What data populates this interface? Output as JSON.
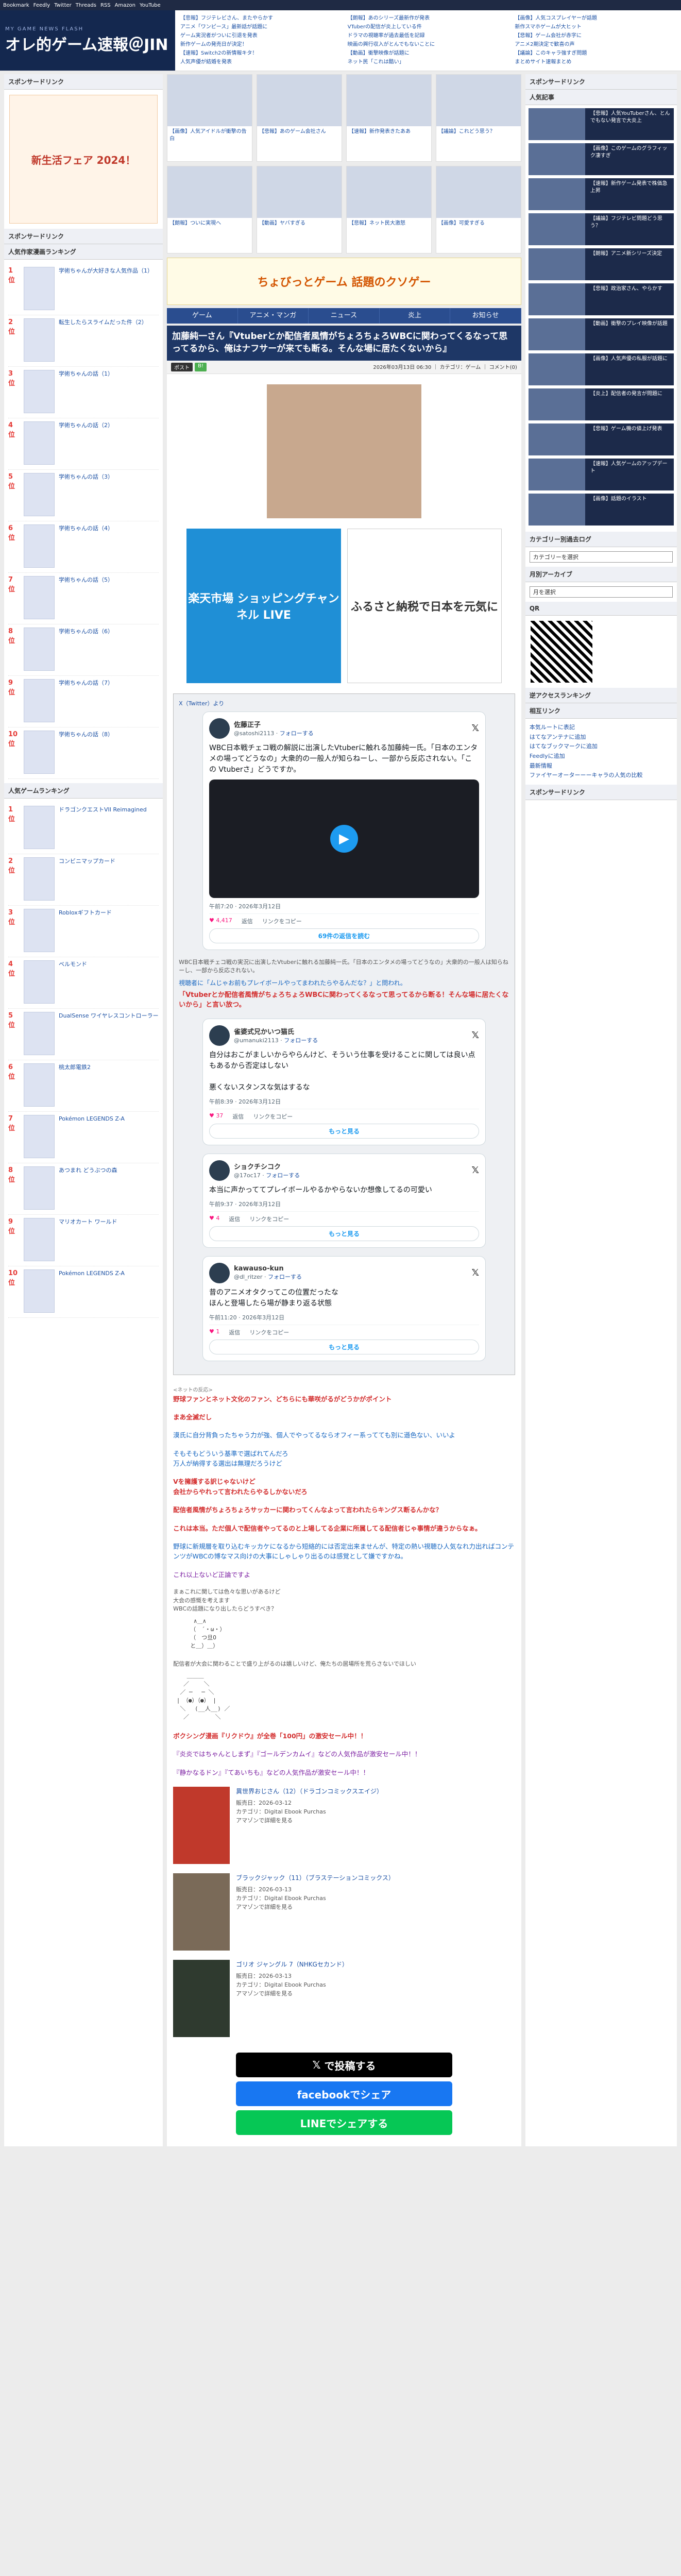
{
  "topbar": [
    "Bookmark",
    "Feedly",
    "Twitter",
    "Threads",
    "RSS",
    "Amazon",
    "YouTube"
  ],
  "site": {
    "sub": "MY GAME NEWS FLASH",
    "title": "オレ的ゲーム速報＠JIN"
  },
  "headlinks": [
    [
      "【悲報】フジテレビさん、またやらかす",
      "アニメ「ワンピース」最新話が話題に",
      "ゲーム実況者がついに引退を発表",
      "新作ゲームの発売日が決定！",
      "【速報】Switch2の新情報キタ！",
      "人気声優が結婚を発表"
    ],
    [
      "【朗報】あのシリーズ最新作が発表",
      "VTuberの配信が炎上している件",
      "ドラマの視聴率が過去最低を記録",
      "映画の興行収入がとんでもないことに",
      "【動画】衝撃映像が話題に",
      "ネット民「これは酷い」"
    ],
    [
      "【画像】人気コスプレイヤーが話題",
      "新作スマホゲームが大ヒット",
      "【悲報】ゲーム会社が赤字に",
      "アニメ2期決定で歓喜の声",
      "【議論】このキャラ強すぎ問題",
      "まとめサイト速報まとめ"
    ]
  ],
  "left": {
    "sponsor": "スポンサードリンク",
    "banner": "新生活フェア 2024！",
    "ranking_title": "人気作家漫画ランキング",
    "ranking": [
      {
        "no": "1位",
        "t": "学術ちゃんが大好きな人気作品（1）"
      },
      {
        "no": "2位",
        "t": "転生したらスライムだった件（2）"
      },
      {
        "no": "3位",
        "t": "学術ちゃんの話（1）"
      },
      {
        "no": "4位",
        "t": "学術ちゃんの話（2）"
      },
      {
        "no": "5位",
        "t": "学術ちゃんの話（3）"
      },
      {
        "no": "6位",
        "t": "学術ちゃんの話（4）"
      },
      {
        "no": "7位",
        "t": "学術ちゃんの話（5）"
      },
      {
        "no": "8位",
        "t": "学術ちゃんの話（6）"
      },
      {
        "no": "9位",
        "t": "学術ちゃんの話（7）"
      },
      {
        "no": "10位",
        "t": "学術ちゃんの話（8）"
      }
    ],
    "game_title": "人気ゲームランキング",
    "games": [
      {
        "no": "1位",
        "t": "ドラゴンクエストVII Reimagined"
      },
      {
        "no": "2位",
        "t": "コンビニマップカード"
      },
      {
        "no": "3位",
        "t": "Robloxギフトカード"
      },
      {
        "no": "4位",
        "t": "ベルモンド"
      },
      {
        "no": "5位",
        "t": "DualSense ワイヤレスコントローラー"
      },
      {
        "no": "6位",
        "t": "桃太郎電鉄2"
      },
      {
        "no": "7位",
        "t": "Pokémon LEGENDS Z-A"
      },
      {
        "no": "8位",
        "t": "あつまれ どうぶつの森"
      },
      {
        "no": "9位",
        "t": "マリオカート ワールド"
      },
      {
        "no": "10位",
        "t": "Pokémon LEGENDS Z-A"
      }
    ],
    "sponsor2": "スポンサードリンク"
  },
  "center": {
    "thumbs": [
      "【画像】人気アイドルが衝撃の告白",
      "【悲報】あのゲーム会社さん",
      "【速報】新作発表きたああ",
      "【議論】これどう思う？",
      "【朗報】ついに実現へ",
      "【動画】ヤバすぎる",
      "【悲報】ネット民大激怒",
      "【画像】可愛すぎる"
    ],
    "ad_strip": "ちょびっとゲーム 話題のクソゲー",
    "nav": [
      "ゲーム",
      "アニメ・マンガ",
      "ニュース",
      "炎上",
      "お知らせ"
    ],
    "title": "加藤純一さん『Vtuberとか配信者風情がちょろちょろWBCに関わってくるなって思ってるから、俺はナフサーが来ても断る。そんな場に居たくないから』",
    "meta": "2026年03月13日 06:30 ｜ カテゴリ：ゲーム ｜ コメント(0)",
    "share": [
      "ポスト",
      "B!"
    ],
    "ads": [
      "楽天市場 ショッピングチャンネル LIVE",
      "ふるさと納税で日本を元気に"
    ],
    "embed_src": "X（Twitter）より",
    "tweet1": {
      "name": "佐藤正子",
      "handle": "@satoshi2113",
      "follow": "フォローする",
      "body": "WBC日本戦チェコ戦の解説に出演したVtuberに触れる加藤純一氏。「日本のエンタメの場ってどうなの」大衆的の一般人が知らねーし、一部から反応されない。「この Vtuberさ」どうですか。",
      "date": "午前7:20 · 2026年3月12日",
      "likes": "4,417",
      "reply": "返信",
      "copy": "リンクをコピー",
      "more": "69件の返信を読む"
    },
    "caption": "WBC日本戦チェコ戦の実況に出演したVtuberに触れる加藤純一氏。「日本のエンタメの場ってどうなの」大衆的の一般人は知らねーし、一部から反応されない。",
    "lead_blue": "視聴者に「ムじゃお前もプレイボールやってまわれたらやるんだな？」と問われ。",
    "lead_red": "「Vtuberとか配信者風情がちょろちょろWBCに関わってくるなって思ってるから断る！そんな場に居たくないから」と言い放つ。",
    "tweet2": {
      "name": "雀婆式兄かいつ猫氏",
      "handle": "@umanuki2113",
      "follow": "フォローする",
      "body": "自分はおこがましいからやらんけど、そういう仕事を受けることに関しては良い点もあるから否定はしない\n\n悪くないスタンスな気はするな",
      "date": "午前8:39 · 2026年3月12日",
      "likes": "37",
      "reply": "返信",
      "copy": "リンクをコピー",
      "more": "もっと見る"
    },
    "tweet3": {
      "name": "ショクチシコク",
      "handle": "@17oc17",
      "follow": "フォローする",
      "body": "本当に声かっててプレイボールやるかやらないか想像してるの可愛い",
      "date": "午前9:37 · 2026年3月12日",
      "likes": "4",
      "reply": "返信",
      "copy": "リンクをコピー",
      "more": "もっと見る"
    },
    "tweet4": {
      "name": "kawauso-kun",
      "handle": "@dl_ritzer",
      "follow": "フォローする",
      "body": "昔のアニメオタクってこの位置だったな\nほんと登場したら場が静まり返る状態",
      "date": "午前11:20 · 2026年3月12日",
      "likes": "1",
      "reply": "返信",
      "copy": "リンクをコピー",
      "more": "もっと見る"
    },
    "comments_head": "<ネットの反応>",
    "comments": [
      {
        "c": "c-red",
        "t": "野球ファンとネット文化のファン、どちらにも華咲がるがどうかがポイント"
      },
      {
        "c": "c-red",
        "t": "まあ全滅だし"
      },
      {
        "c": "c-blue",
        "t": "漠氏に自分背負ったちゃう力が強、個人でやってるならオフィー系ってても別に遜色ない、いいよ"
      },
      {
        "c": "c-blue",
        "t": "そもそもどういう基準で選ばれてんだろ\n万人が納得する選出は無理だろうけど"
      },
      {
        "c": "c-red",
        "t": "Vを擁護する訳じゃないけど\n会社からやれって言われたらやるしかないだろ"
      },
      {
        "c": "c-red",
        "t": "配信者風情がちょろちょろサッカーに関わってくんなよって言われたらキングス断るんかな？"
      },
      {
        "c": "c-red",
        "t": "これは本当。ただ個人で配信者やってるのと上場してる企業に所属してる配信者じゃ事情が違うからなぁ。"
      },
      {
        "c": "c-blue",
        "t": "野球に新規層を取り込むキッカケになるから短絡的には否定出来ませんが、特定の熱い視聴ひ人気なれ力出ればコンテンツがWBCの博なマス向けの大事にしゃしゃり出るのは感覚として嫌ですかね。"
      },
      {
        "c": "c-purple",
        "t": "これ以上ないど正論ですよ"
      }
    ],
    "aa1_text": "まぁこれに関しては色々な思いがあるけど\n大会の感慨を考えます\nWBCの話題になり出したらどうすべき？",
    "aa2_text": "配信者が大会に関わることで盛り上がるのは嬉しいけど、俺たちの居場所を荒らさないでほしい",
    "promo": [
      {
        "c": "c-red",
        "t": "ボクシング漫画『リクドウ』が全巻「100円」の激安セール中！！"
      },
      {
        "c": "c-purple",
        "t": "『炎炎ではちゃんとしまず』『ゴールデンカムイ』などの人気作品が激安セール中！！"
      },
      {
        "c": "c-purple",
        "t": "『静かなるドン』『てあいちも』などの人気作品が激安セール中！！"
      }
    ],
    "products": [
      {
        "ttl": "異世界おじさん（12）（ドラゴンコミックスエイジ）",
        "info": "販売日：2026-03-12\nカテゴリ：Digital Ebook Purchas\nアマゾンで詳細を見る"
      },
      {
        "ttl": "ブラックジャック（11）（ブラステーションコミックス）",
        "info": "販売日：2026-03-13\nカテゴリ：Digital Ebook Purchas\nアマゾンで詳細を見る"
      },
      {
        "ttl": "ゴリオ ジャングル 7（NHKGセカンド）",
        "info": "販売日：2026-03-13\nカテゴリ：Digital Ebook Purchas\nアマゾンで詳細を見る"
      }
    ],
    "share_big": [
      "で投稿する",
      "facebookでシェア",
      "LINEでシェアする"
    ]
  },
  "right": {
    "sponsor": "スポンサードリンク",
    "pop_title": "人気記事",
    "pop": [
      "【悲報】人気YouTuberさん、とんでもない発言で大炎上",
      "【画像】このゲームのグラフィック凄すぎ",
      "【速報】新作ゲーム発表で株価急上昇",
      "【議論】フジテレビ問題どう思う？",
      "【朗報】アニメ新シリーズ決定",
      "【悲報】政治家さん、やらかす",
      "【動画】衝撃のプレイ映像が話題",
      "【画像】人気声優の私服が話題に",
      "【炎上】配信者の発言が問題に",
      "【悲報】ゲーム機の値上げ発表",
      "【速報】人気ゲームのアップデート",
      "【画像】話題のイラスト"
    ],
    "cat_title": "カテゴリー別過去ログ",
    "cat_select": "カテゴリーを選択",
    "month_title": "月別アーカイブ",
    "month_select": "月を選択",
    "qr_title": "QR",
    "rank_title": "逆アクセスランキング",
    "link_title": "相互リンク",
    "links": [
      "本気ルートに表記",
      "はてなアンテナに追加",
      "はてなブックマークに追加",
      "Feedlyに追加",
      "最新情報",
      "ファイヤーオーターーーキャラの人気の比較"
    ],
    "sponsor2": "スポンサードリンク"
  }
}
